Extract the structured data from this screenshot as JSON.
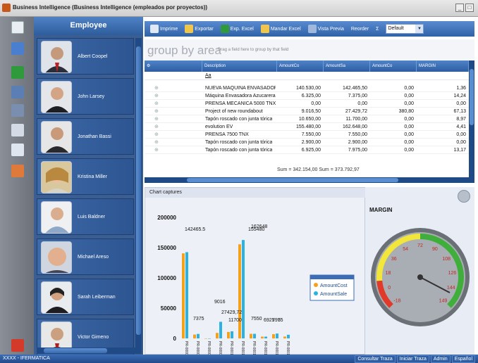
{
  "window": {
    "title": "Business Intelligence (Business Intelligence (empleados por proyectos))",
    "controls": [
      "_",
      "□"
    ]
  },
  "employee_panel": {
    "header": "Employee",
    "employees": [
      "Albert Coopel",
      "John Larsey",
      "Jonathan Bassi",
      "Kristina Miller",
      "Luis Baldner",
      "Michael Areso",
      "Sarah Leiberman",
      "Victor Gimeno"
    ]
  },
  "toolbar": {
    "buttons": [
      "Imprime",
      "Exportar",
      "Exp. Excel",
      "Mandar Excel",
      "Vista Previa",
      "Reorder",
      "Σ"
    ],
    "layout_select": "Default"
  },
  "group_area": {
    "title": "group by area",
    "hint": "Drag a field here to group by that field"
  },
  "grid": {
    "columns": [
      "Description",
      "AmountCo",
      "AmountSa",
      "AmountCo",
      "MARGIN"
    ],
    "filter_value": "Aa",
    "rows": [
      [
        "NUEVA MAQUINA ENVASADORA",
        "140.530,00",
        "142.465,50",
        "0,00",
        "1,36"
      ],
      [
        "Máquina Envasadora Azucarera",
        "6.325,00",
        "7.375,00",
        "0,00",
        "14,24"
      ],
      [
        "PRENSA MECANICA 5000 TNX",
        "0,00",
        "0,00",
        "0,00",
        "0,00"
      ],
      [
        "Project of new roundabout",
        "9.016,50",
        "27.429,72",
        "380,80",
        "67,13"
      ],
      [
        "Tapón roscado con junta tórica",
        "10.650,00",
        "11.700,00",
        "0,00",
        "8,97"
      ],
      [
        "evolution EV",
        "155.480,00",
        "162.648,00",
        "0,00",
        "4,41"
      ],
      [
        "PRENSA 7500 TNX",
        "7.550,00",
        "7.550,00",
        "0,00",
        "0,00"
      ],
      [
        "Tapón roscado con junta tórica",
        "2.900,00",
        "2.900,00",
        "0,00",
        "0,00"
      ],
      [
        "Tapón roscado con junta tórica",
        "6.925,00",
        "7.975,00",
        "0,00",
        "13,17"
      ]
    ],
    "summary": "Sum = 342.154,00  Sum = 373.792,97"
  },
  "chart_panel": {
    "header": "Chart captures"
  },
  "chart_data": {
    "type": "bar",
    "categories": [
      "PR-00001",
      "PR-00002",
      "PR-00003",
      "PR-00007",
      "PR-00010",
      "PR-00018",
      "PR-00011",
      "PR-00012",
      "PR-00015",
      "PR-00016"
    ],
    "series": [
      {
        "name": "AmountCost",
        "color": "#f5a11e",
        "values": [
          140530,
          6325,
          0,
          9016.5,
          10650,
          155480,
          7550,
          2900,
          6925,
          3000
        ]
      },
      {
        "name": "AmountSale",
        "color": "#2ab3e0",
        "values": [
          142465.5,
          7375,
          0,
          27429.72,
          11700,
          162648,
          7550,
          2900,
          7975,
          6000
        ]
      }
    ],
    "value_labels": [
      "142465.5",
      "7375",
      "9016",
      "27429,72",
      "11700",
      "155480",
      "162648",
      "7550",
      "6925",
      "7975",
      "5"
    ],
    "yticks": [
      "0",
      "50000",
      "100000",
      "150000",
      "200000"
    ],
    "ylim": [
      0,
      200000
    ]
  },
  "gauge": {
    "title": "MARGIN",
    "ticks": [
      "-18",
      "0",
      "18",
      "36",
      "54",
      "72",
      "90",
      "108",
      "126",
      "144",
      "149"
    ]
  },
  "statusbar": {
    "left": "XXXX - IFERMATICA",
    "buttons": [
      "Consultar Traza",
      "Iniciar Traza",
      "Admin",
      "Español"
    ]
  }
}
